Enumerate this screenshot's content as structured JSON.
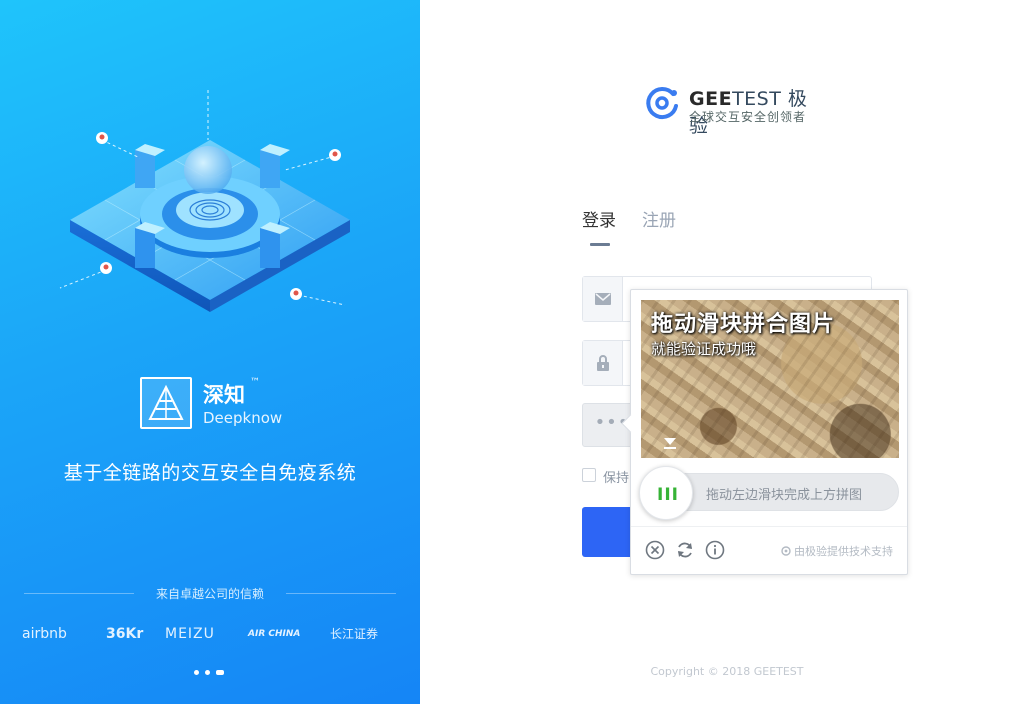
{
  "brand": {
    "name": "深知",
    "trademark": "™",
    "english": "Deepknow"
  },
  "tagline": "基于全链路的交互安全自免疫系统",
  "trust_text": "来自卓越公司的信赖",
  "partners": [
    "airbnb",
    "36Kr",
    "MEIZU",
    "AIR CHINA",
    "长江证券"
  ],
  "carousel": {
    "count": 3,
    "active_index": 2
  },
  "logo": {
    "name_bold": "GEE",
    "name_rest": "TEST 极验",
    "subtitle": "全球交互安全创领者"
  },
  "tabs": [
    {
      "label": "登录",
      "active": true
    },
    {
      "label": "注册",
      "active": false
    }
  ],
  "form": {
    "email_icon": "envelope-icon",
    "password_icon": "lock-icon",
    "verify_dots": "•••",
    "keep_label": "保持"
  },
  "captcha": {
    "title": "拖动滑块拼合图片",
    "subtitle": "就能验证成功哦",
    "track_text": "拖动左边滑块完成上方拼图",
    "knob_grip": "III",
    "powered_by": "由极验提供技术支持",
    "slider_progress": 0
  },
  "copyright": "Copyright © 2018 GEETEST",
  "colors": {
    "left_gradient_start": "#1fc4fb",
    "left_gradient_end": "#1585f6",
    "primary_button": "#2d65f5",
    "knob_grip": "#36b336"
  }
}
